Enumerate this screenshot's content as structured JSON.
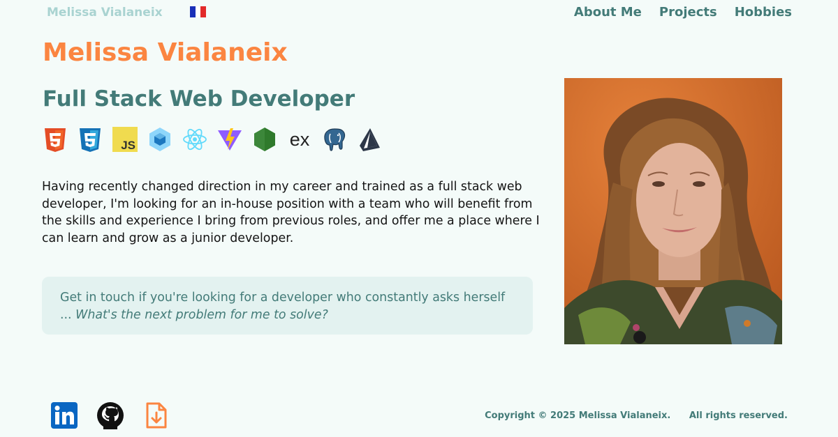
{
  "header": {
    "brand": "Melissa Vialaneix",
    "language_flag": "french-flag",
    "nav": [
      {
        "label": "About Me"
      },
      {
        "label": "Projects"
      },
      {
        "label": "Hobbies"
      }
    ]
  },
  "hero": {
    "name": "Melissa Vialaneix",
    "role": "Full Stack Web Developer",
    "tech_icons": [
      "html5-icon",
      "css3-icon",
      "javascript-icon",
      "webpack-icon",
      "react-icon",
      "vite-icon",
      "nodejs-icon",
      "express-icon",
      "postgresql-icon",
      "prisma-icon"
    ],
    "express_text": "ex",
    "js_text": "JS",
    "about": "Having recently changed direction in my career and trained as a full stack web developer, I'm looking for an in-house position with a team who will benefit from the skills and experience I bring from previous roles, and offer me a place where I can learn and grow as a junior developer.",
    "cta_text": "Get in touch if you're looking for a developer who constantly asks herself ... ",
    "cta_question": "What's the next problem for me to solve?"
  },
  "footer": {
    "social_icons": [
      "linkedin-icon",
      "github-icon",
      "download-cv-icon"
    ],
    "copyright": "Copyright © 2025 Melissa Vialaneix.",
    "rights": "All rights reserved."
  },
  "colors": {
    "background": "#f4fbf9",
    "accent_orange": "#fb8541",
    "teal": "#437b78",
    "brand_light": "#a9d3d1",
    "cta_bg": "#e3f2f0"
  }
}
